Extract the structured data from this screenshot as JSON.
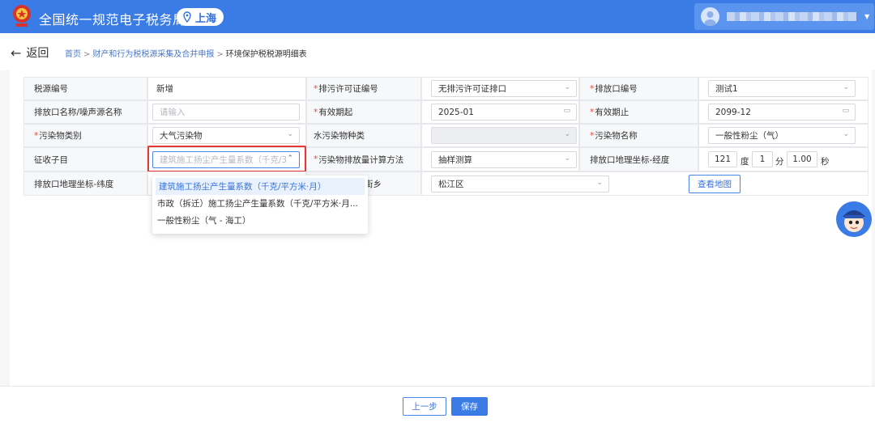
{
  "header": {
    "app_title": "全国统一规范电子税务局",
    "region": "上海",
    "logo_icon": "tax-emblem-icon",
    "user_icon": "user-avatar-icon"
  },
  "breadcrumb": {
    "back_label": "返回",
    "items": [
      "首页",
      "财产和行为税税源采集及合并申报",
      "环境保护税税源明细表"
    ],
    "separator": ">"
  },
  "form": {
    "row1": {
      "l1": "税源编号",
      "v1": "新增",
      "l2": "排污许可证编号",
      "v2": "无排污许可证排口",
      "l3": "排放口编号",
      "v3": "测试1"
    },
    "row2": {
      "l1": "排放口名称/噪声源名称",
      "v1_placeholder": "请输入",
      "l2": "有效期起",
      "v2": "2025-01",
      "l3": "有效期止",
      "v3": "2099-12"
    },
    "row3": {
      "l1": "污染物类别",
      "v1": "大气污染物",
      "l2": "水污染物种类",
      "v2": "",
      "l3": "污染物名称",
      "v3": "一般性粉尘（气）"
    },
    "row4": {
      "l1": "征收子目",
      "v1": "建筑施工扬尘产生量系数（千克/3",
      "l2": "污染物排放量计算方法",
      "v2": "抽样测算",
      "l3": "排放口地理坐标-经度",
      "lng_deg": "121",
      "lng_deg_unit": "度",
      "lng_min": "1",
      "lng_min_unit": "分",
      "lng_sec": "1.00",
      "lng_sec_unit": "秒"
    },
    "row5": {
      "l1": "排放口地理坐标-纬度",
      "l2_tail": "街乡",
      "v2": "松江区",
      "map_button": "查看地图"
    }
  },
  "dropdown": {
    "options": [
      "建筑施工扬尘产生量系数（千克/平方米·月）",
      "市政（拆迁）施工扬尘产生量系数（千克/平方米·月...",
      "一般性粉尘（气 - 海工）"
    ],
    "selected_index": 0
  },
  "footer": {
    "prev_label": "上一步",
    "save_label": "保存"
  },
  "colors": {
    "brand": "#3a7be6",
    "required": "#e74c3c",
    "highlight_border": "#e53935"
  }
}
